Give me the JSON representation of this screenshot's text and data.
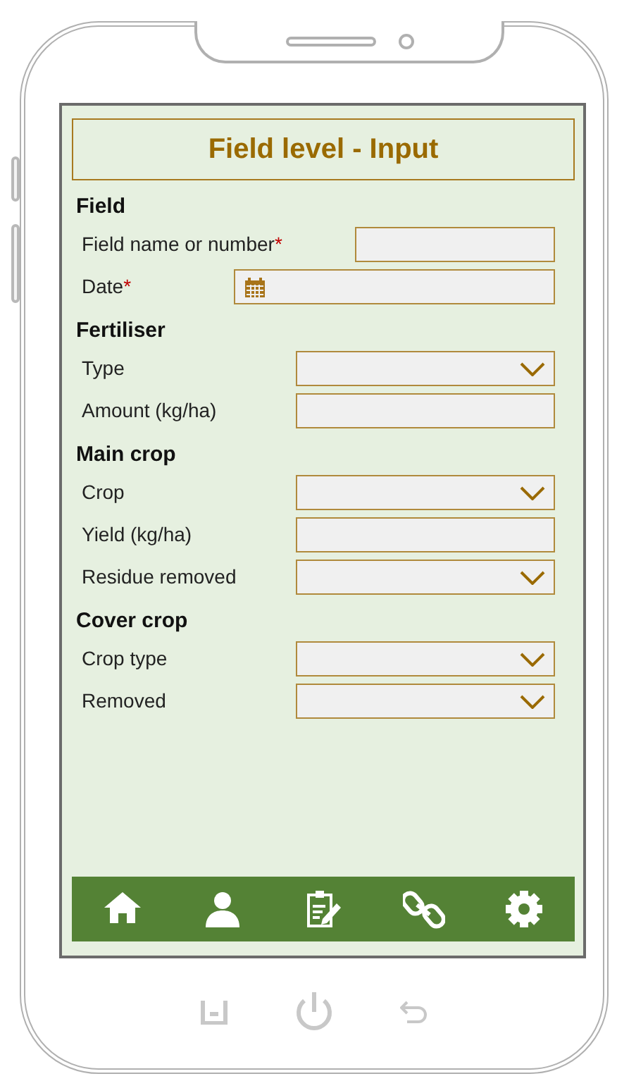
{
  "title": "Field level - Input",
  "sections": [
    {
      "heading": "Field",
      "fields": [
        {
          "kind": "text",
          "label": "Field name or number",
          "required_mark": "*"
        },
        {
          "kind": "date",
          "label": "Date",
          "required_mark": "*"
        }
      ]
    },
    {
      "heading": "Fertiliser",
      "fields": [
        {
          "kind": "dropdown",
          "label": "Type"
        },
        {
          "kind": "text",
          "label": "Amount (kg/ha)"
        }
      ]
    },
    {
      "heading": "Main crop",
      "fields": [
        {
          "kind": "dropdown",
          "label": "Crop"
        },
        {
          "kind": "text",
          "label": "Yield (kg/ha)"
        },
        {
          "kind": "dropdown",
          "label": "Residue removed"
        }
      ]
    },
    {
      "heading": "Cover crop",
      "fields": [
        {
          "kind": "dropdown",
          "label": "Crop type"
        },
        {
          "kind": "dropdown",
          "label": "Removed"
        }
      ]
    }
  ]
}
